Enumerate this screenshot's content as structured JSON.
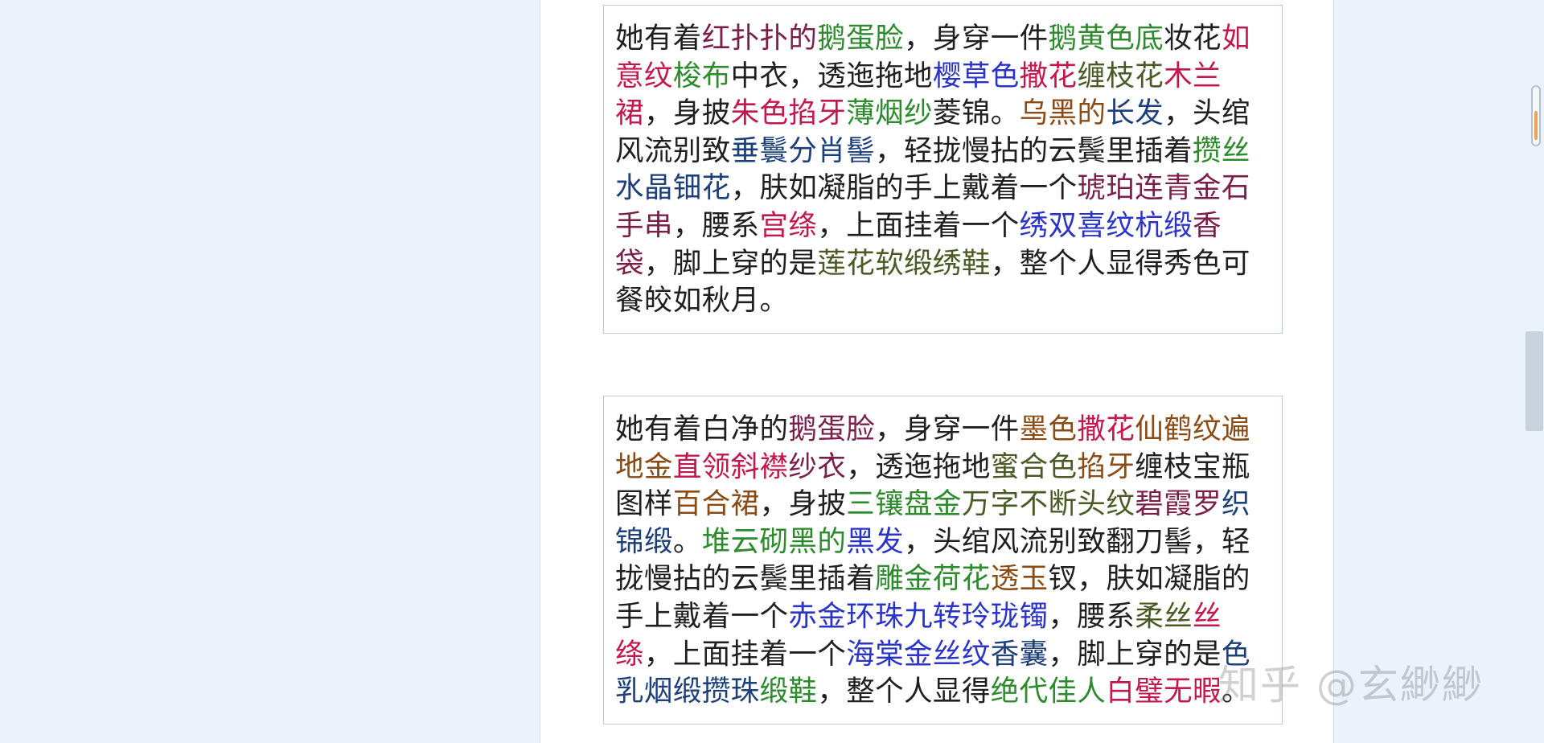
{
  "colors": {
    "default": "#1f1f1f",
    "red": "#c2184d",
    "green": "#2d8a2d",
    "blue": "#2b34c8",
    "brown": "#8a4b14",
    "olive": "#4a5a24",
    "navy": "#1d3f7a",
    "maroon": "#7a1f4a"
  },
  "passages": [
    {
      "segments": [
        {
          "t": "她有着",
          "c": "default"
        },
        {
          "t": "红扑扑的",
          "c": "maroon"
        },
        {
          "t": "鹅蛋脸",
          "c": "green"
        },
        {
          "t": "，身穿一件",
          "c": "default"
        },
        {
          "t": "鹅黄色底",
          "c": "green"
        },
        {
          "t": "妆花",
          "c": "default"
        },
        {
          "t": "如意纹",
          "c": "red"
        },
        {
          "t": "梭布",
          "c": "green"
        },
        {
          "t": "中衣，透迤拖地",
          "c": "default"
        },
        {
          "t": "樱草色",
          "c": "blue"
        },
        {
          "t": "撒花",
          "c": "red"
        },
        {
          "t": "缠枝花",
          "c": "olive"
        },
        {
          "t": "木兰裙",
          "c": "red"
        },
        {
          "t": "，身披",
          "c": "default"
        },
        {
          "t": "朱色",
          "c": "red"
        },
        {
          "t": "掐牙",
          "c": "red"
        },
        {
          "t": "薄烟纱",
          "c": "green"
        },
        {
          "t": "菱锦。",
          "c": "default"
        },
        {
          "t": "乌黑的",
          "c": "brown"
        },
        {
          "t": "长发",
          "c": "navy"
        },
        {
          "t": "，头绾风流别致",
          "c": "default"
        },
        {
          "t": "垂鬟分肖髻",
          "c": "navy"
        },
        {
          "t": "，轻拢慢拈的云鬓里插着",
          "c": "default"
        },
        {
          "t": "攒丝",
          "c": "green"
        },
        {
          "t": "水晶钿花",
          "c": "navy"
        },
        {
          "t": "，肤如凝脂的手上戴着一个",
          "c": "default"
        },
        {
          "t": "琥珀连青金石手串",
          "c": "maroon"
        },
        {
          "t": "，腰系",
          "c": "default"
        },
        {
          "t": "宫绦",
          "c": "red"
        },
        {
          "t": "，上面挂着一个",
          "c": "default"
        },
        {
          "t": "绣双喜纹杭缎",
          "c": "blue"
        },
        {
          "t": "香袋",
          "c": "maroon"
        },
        {
          "t": "，脚上穿的是",
          "c": "default"
        },
        {
          "t": "莲花软缎绣鞋",
          "c": "olive"
        },
        {
          "t": "，整个人显得秀色可餐皎如秋月。",
          "c": "default"
        }
      ]
    },
    {
      "segments": [
        {
          "t": "她有着白净的",
          "c": "default"
        },
        {
          "t": "鹅蛋脸",
          "c": "maroon"
        },
        {
          "t": "，身穿一件",
          "c": "default"
        },
        {
          "t": "墨色",
          "c": "brown"
        },
        {
          "t": "撒花",
          "c": "red"
        },
        {
          "t": "仙鹤纹",
          "c": "brown"
        },
        {
          "t": "遍地金",
          "c": "brown"
        },
        {
          "t": "直领斜襟",
          "c": "red"
        },
        {
          "t": "纱衣",
          "c": "maroon"
        },
        {
          "t": "，透迤拖地",
          "c": "default"
        },
        {
          "t": "蜜合色",
          "c": "olive"
        },
        {
          "t": "掐牙",
          "c": "brown"
        },
        {
          "t": "缠枝宝瓶图样",
          "c": "default"
        },
        {
          "t": "百合裙",
          "c": "brown"
        },
        {
          "t": "，身披",
          "c": "default"
        },
        {
          "t": "三镶盘金",
          "c": "green"
        },
        {
          "t": "万字不断头纹",
          "c": "olive"
        },
        {
          "t": "碧霞罗",
          "c": "maroon"
        },
        {
          "t": "织锦缎",
          "c": "navy"
        },
        {
          "t": "。",
          "c": "default"
        },
        {
          "t": "堆云砌黑的",
          "c": "green"
        },
        {
          "t": "黑发",
          "c": "blue"
        },
        {
          "t": "，头绾风流别致翻刀髻，轻拢慢拈的云鬓里插着",
          "c": "default"
        },
        {
          "t": "雕金荷花",
          "c": "green"
        },
        {
          "t": "透玉",
          "c": "brown"
        },
        {
          "t": "钗，肤如凝脂的手上戴着一个",
          "c": "default"
        },
        {
          "t": "赤金环珠九转玲珑镯",
          "c": "blue"
        },
        {
          "t": "，腰系",
          "c": "default"
        },
        {
          "t": "柔丝",
          "c": "olive"
        },
        {
          "t": "丝绦",
          "c": "red"
        },
        {
          "t": "，上面挂着一个",
          "c": "default"
        },
        {
          "t": "海棠金丝纹",
          "c": "blue"
        },
        {
          "t": "香囊",
          "c": "navy"
        },
        {
          "t": "，脚上穿的是",
          "c": "default"
        },
        {
          "t": "色乳烟缎攒珠",
          "c": "navy"
        },
        {
          "t": "缎鞋",
          "c": "green"
        },
        {
          "t": "，整个人显得",
          "c": "default"
        },
        {
          "t": "绝代佳人",
          "c": "green"
        },
        {
          "t": "白璧无暇",
          "c": "red"
        },
        {
          "t": "。",
          "c": "default"
        }
      ]
    }
  ],
  "watermark": "知乎 @玄緲緲"
}
